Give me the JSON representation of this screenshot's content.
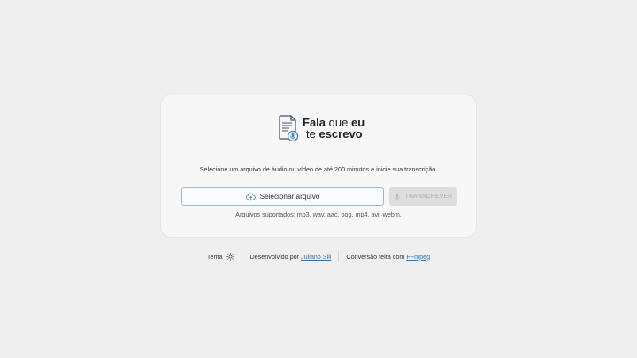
{
  "logo": {
    "line1_bold_a": "Fala",
    "line1_light": "que",
    "line1_bold_b": "eu",
    "line2_light": "te",
    "line2_bold": "escrevo",
    "icon": "document-mic-icon"
  },
  "description": "Selecione um arquivo de áudio ou vídeo de até 200 minutos e inicie sua transcrição.",
  "select_button": {
    "label": "Selecionar arquivo",
    "icon": "cloud-upload-icon"
  },
  "transcribe_button": {
    "label": "TRANSCREVER",
    "icon": "mic-icon",
    "enabled": false
  },
  "supported_formats": "Arquivos suportados: mp3, wav, aac, oog, mp4, avi, webm.",
  "footer": {
    "theme_label": "Tema",
    "theme_icon": "sun-icon",
    "developed_prefix": "Desenvolvido por",
    "developer_name": "Juliano Sill",
    "conversion_prefix": "Conversão feita com",
    "conversion_tool": "FFmpeg"
  },
  "colors": {
    "background": "#efefef",
    "card": "#f7f7f7",
    "accent": "#3c6fa3",
    "select_border": "#9fb7d3",
    "disabled_button": "#dedede"
  }
}
